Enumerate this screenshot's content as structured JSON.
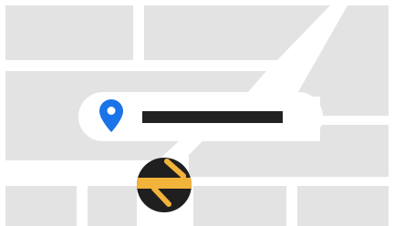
{
  "map": {
    "background_color": "#ffffff",
    "block_color": "#e3e3e3",
    "road_color": "#ffffff"
  },
  "search": {
    "value": "",
    "pin_icon": "location-pin-icon",
    "pin_color": "#1a73e8",
    "placeholder_bar_color": "#222222"
  },
  "vehicle": {
    "icon": "vehicle-marker-icon",
    "body_color": "#1f1f1f",
    "stripe_color": "#f2b33a"
  }
}
